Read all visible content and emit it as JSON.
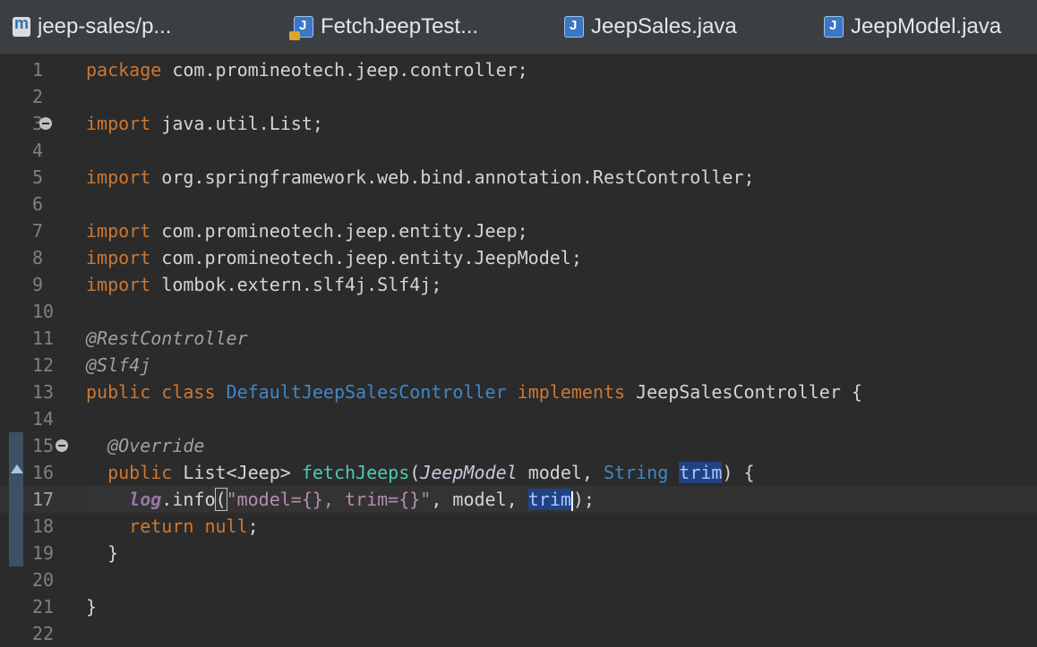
{
  "tabs": [
    {
      "label": "jeep-sales/p...",
      "icon": "maven-pom-icon"
    },
    {
      "label": "FetchJeepTest...",
      "icon": "java-test-file-icon"
    },
    {
      "label": "JeepSales.java",
      "icon": "java-file-icon"
    },
    {
      "label": "JeepModel.java",
      "icon": "java-file-icon"
    }
  ],
  "code": {
    "lines": [
      {
        "num": "1",
        "text": "package com.promineotech.jeep.controller;"
      },
      {
        "num": "2",
        "text": ""
      },
      {
        "num": "3",
        "text": "import java.util.List;"
      },
      {
        "num": "4",
        "text": ""
      },
      {
        "num": "5",
        "text": "import org.springframework.web.bind.annotation.RestController;"
      },
      {
        "num": "6",
        "text": ""
      },
      {
        "num": "7",
        "text": "import com.promineotech.jeep.entity.Jeep;"
      },
      {
        "num": "8",
        "text": "import com.promineotech.jeep.entity.JeepModel;"
      },
      {
        "num": "9",
        "text": "import lombok.extern.slf4j.Slf4j;"
      },
      {
        "num": "10",
        "text": ""
      },
      {
        "num": "11",
        "text": "@RestController"
      },
      {
        "num": "12",
        "text": "@Slf4j"
      },
      {
        "num": "13",
        "text": "public class DefaultJeepSalesController implements JeepSalesController {"
      },
      {
        "num": "14",
        "text": ""
      },
      {
        "num": "15",
        "text": "  @Override"
      },
      {
        "num": "16",
        "text": "  public List<Jeep> fetchJeeps(JeepModel model, String trim) {"
      },
      {
        "num": "17",
        "text": "    log.info(\"model={}, trim={}\", model, trim);"
      },
      {
        "num": "18",
        "text": "    return null;"
      },
      {
        "num": "19",
        "text": "  }"
      },
      {
        "num": "20",
        "text": ""
      },
      {
        "num": "21",
        "text": "}"
      },
      {
        "num": "22",
        "text": ""
      }
    ]
  },
  "tokens": {
    "l1_kw": "package",
    "l1_rest": " com.promineotech.jeep.controller;",
    "l3_kw": "import",
    "l3_rest": " java.util.List;",
    "l5_kw": "import",
    "l5_rest": " org.springframework.web.bind.annotation.RestController;",
    "l7_kw": "import",
    "l7_rest": " com.promineotech.jeep.entity.Jeep;",
    "l8_kw": "import",
    "l8_rest": " com.promineotech.jeep.entity.JeepModel;",
    "l9_kw": "import",
    "l9_rest": " lombok.extern.slf4j.Slf4j;",
    "l11": "@RestController",
    "l12": "@Slf4j",
    "l13_kw1": "public class",
    "l13_cls": " DefaultJeepSalesController",
    "l13_kw2": " implements",
    "l13_rest": " JeepSalesController {",
    "l15": "  @Override",
    "l16_kw": "  public",
    "l16_a": " List<Jeep> ",
    "l16_meth": "fetchJeeps",
    "l16_b": "(",
    "l16_type": "JeepModel",
    "l16_c": " model, ",
    "l16_str": "String",
    "l16_d": " ",
    "l16_trim": "trim",
    "l16_e": ") {",
    "l17_indent": "    ",
    "l17_log": "log",
    "l17_a": ".info",
    "l17_paren": "(",
    "l17_str": "\"model={}, trim={}\"",
    "l17_b": ", model, ",
    "l17_trim": "trim",
    "l17_c": ");",
    "l18_kw": "    return null",
    "l18_rest": ";",
    "l19": "  }",
    "l21": "}"
  },
  "colors": {
    "background": "#2b2b2b",
    "keyword": "#cc7832",
    "string": "#6a8759",
    "selection_highlight": "#214283"
  }
}
